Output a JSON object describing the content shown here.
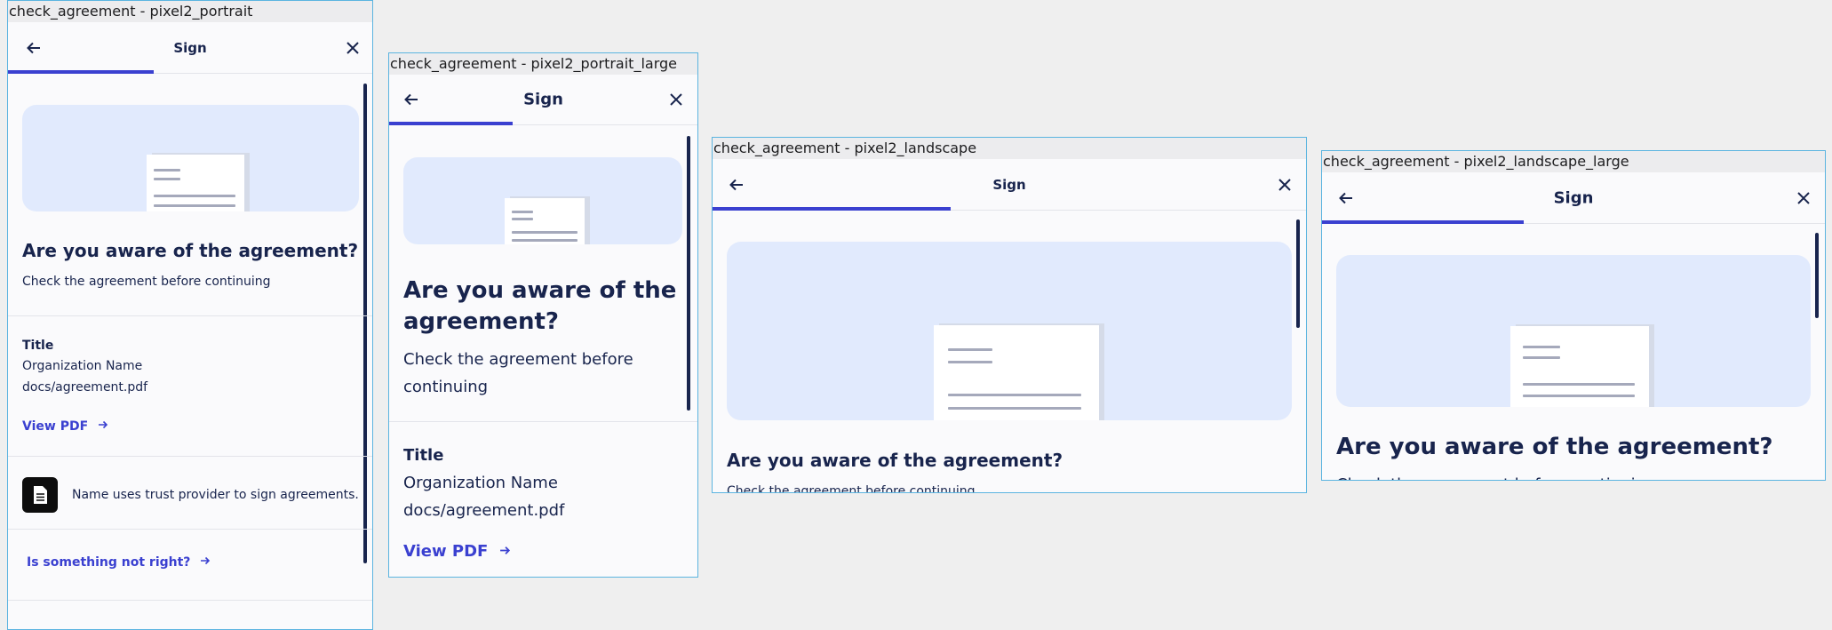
{
  "frames": {
    "portrait": "check_agreement - pixel2_portrait",
    "portrait_large": "check_agreement - pixel2_portrait_large",
    "landscape": "check_agreement - pixel2_landscape",
    "landscape_large": "check_agreement - pixel2_landscape_large"
  },
  "appbar": {
    "title": "Sign"
  },
  "content": {
    "heading": "Are you aware of the agreement?",
    "heading_line1": "Are you aware of the",
    "heading_line2": "agreement?",
    "subtitle": "Check the agreement before continuing",
    "subtitle_line1": "Check the agreement before",
    "subtitle_line2": "continuing",
    "title_label": "Title",
    "organization": "Organization Name",
    "file": "docs/agreement.pdf",
    "view_pdf": "View PDF",
    "trust_notice": "Name uses trust provider to sign agreements.",
    "help_link": "Is something not right?"
  },
  "progress_fraction": 0.4,
  "colors": {
    "accent": "#3a40d0",
    "text": "#18244d",
    "hero": "#e1eafd",
    "frame_border": "#5bb4e0"
  },
  "icons": {
    "back": "arrow-left-icon",
    "close": "close-icon",
    "link_arrow": "arrow-right-icon",
    "document": "document-icon"
  }
}
